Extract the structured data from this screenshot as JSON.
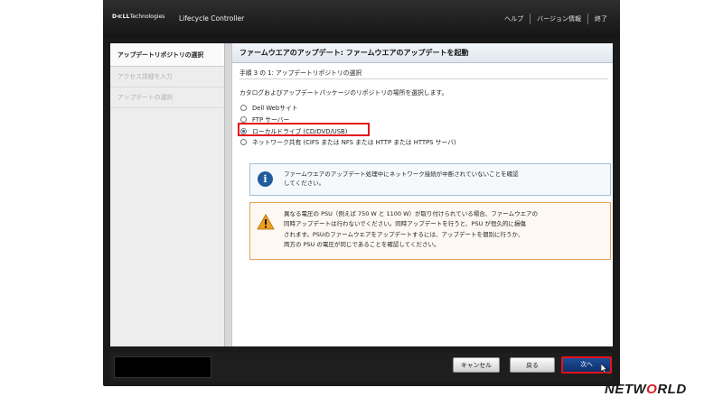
{
  "header": {
    "logo_brand": "D≪LL",
    "logo_suffix": "Technologies",
    "app_title": "Lifecycle Controller",
    "nav": {
      "help": "ヘルプ",
      "about": "バージョン情報",
      "exit": "終了"
    }
  },
  "sidebar": {
    "items": [
      {
        "label": "アップデートリポジトリの選択",
        "state": "active"
      },
      {
        "label": "アクセス詳細を入力",
        "state": "disabled"
      },
      {
        "label": "アップデートの選択",
        "state": "disabled"
      }
    ]
  },
  "main": {
    "title": "ファームウエアのアップデート: ファームウエアのアップデートを起動",
    "step": "手順 3 の 1: アップデートリポジトリの選択",
    "instruction": "カタログおよびアップデートパッケージのリポジトリの場所を選択します。",
    "options": [
      {
        "label": "Dell Webサイト",
        "selected": false
      },
      {
        "label": "FTP サーバー",
        "selected": false
      },
      {
        "label": "ローカルドライブ (CD/DVD/USB)",
        "selected": true
      },
      {
        "label": "ネットワーク共有 (CIFS または NFS または HTTP または HTTPS サーバ)",
        "selected": false
      }
    ],
    "info": {
      "icon": "info-icon",
      "line1": "ファームウエアのアップデート処理中にネットワーク接続が中断されていないことを確認",
      "line2": "してください。"
    },
    "warning": {
      "icon": "warning-icon",
      "line1": "異なる電圧の PSU（例えば 750 W と 1100 W）が取り付けられている場合、ファームウエアの",
      "line2": "同時アップデートは行わないでください。同時アップデートを行うと、PSU が恒久的に損傷",
      "line3": "されます。PSUのファームウエアをアップデートするには、アップデートを個別に行うか、",
      "line4": "両方の PSU の電圧が同じであることを確認してください。"
    }
  },
  "footer": {
    "cancel": "キャンセル",
    "back": "戻る",
    "next": "次へ"
  },
  "watermark": {
    "text_pre": "NETW",
    "text_o": "O",
    "text_post": "RLD"
  },
  "colors": {
    "highlight": "#e3121b",
    "accent": "#1f5c9e",
    "next_button": "#1d4f9a",
    "warning": "#f0a020"
  }
}
